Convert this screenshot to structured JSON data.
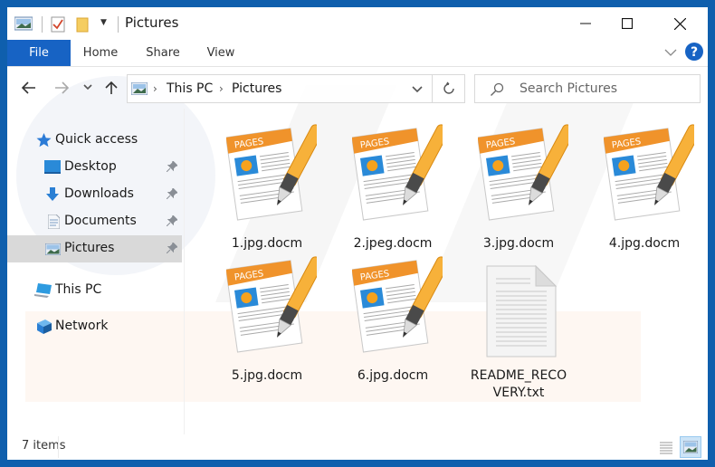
{
  "window": {
    "title": "Pictures",
    "controls": {
      "minimize": "minimize",
      "maximize": "maximize",
      "close": "close"
    }
  },
  "ribbon": {
    "tabs": [
      {
        "label": "File",
        "active": true
      },
      {
        "label": "Home"
      },
      {
        "label": "Share"
      },
      {
        "label": "View"
      }
    ],
    "accent": "#1763c4"
  },
  "navigation": {
    "breadcrumb": [
      "This PC",
      "Pictures"
    ],
    "search_placeholder": "Search Pictures"
  },
  "sidebar": {
    "items": [
      {
        "label": "Quick access",
        "icon": "star-icon"
      },
      {
        "label": "Desktop",
        "icon": "desktop-icon",
        "pinned": true
      },
      {
        "label": "Downloads",
        "icon": "download-icon",
        "pinned": true
      },
      {
        "label": "Documents",
        "icon": "documents-icon",
        "pinned": true
      },
      {
        "label": "Pictures",
        "icon": "pictures-icon",
        "pinned": true,
        "selected": true
      },
      {
        "label": "This PC",
        "icon": "computer-icon"
      },
      {
        "label": "Network",
        "icon": "network-icon"
      }
    ]
  },
  "files": [
    {
      "name": "1.jpg.docm",
      "icon": "pages-document-icon"
    },
    {
      "name": "2.jpeg.docm",
      "icon": "pages-document-icon"
    },
    {
      "name": "3.jpg.docm",
      "icon": "pages-document-icon"
    },
    {
      "name": "4.jpg.docm",
      "icon": "pages-document-icon"
    },
    {
      "name": "5.jpg.docm",
      "icon": "pages-document-icon"
    },
    {
      "name": "6.jpg.docm",
      "icon": "pages-document-icon"
    },
    {
      "name": "README_RECOVERY.txt",
      "icon": "text-file-icon"
    }
  ],
  "pages_icon_label": "PAGES",
  "status": {
    "item_count": "7 items"
  }
}
